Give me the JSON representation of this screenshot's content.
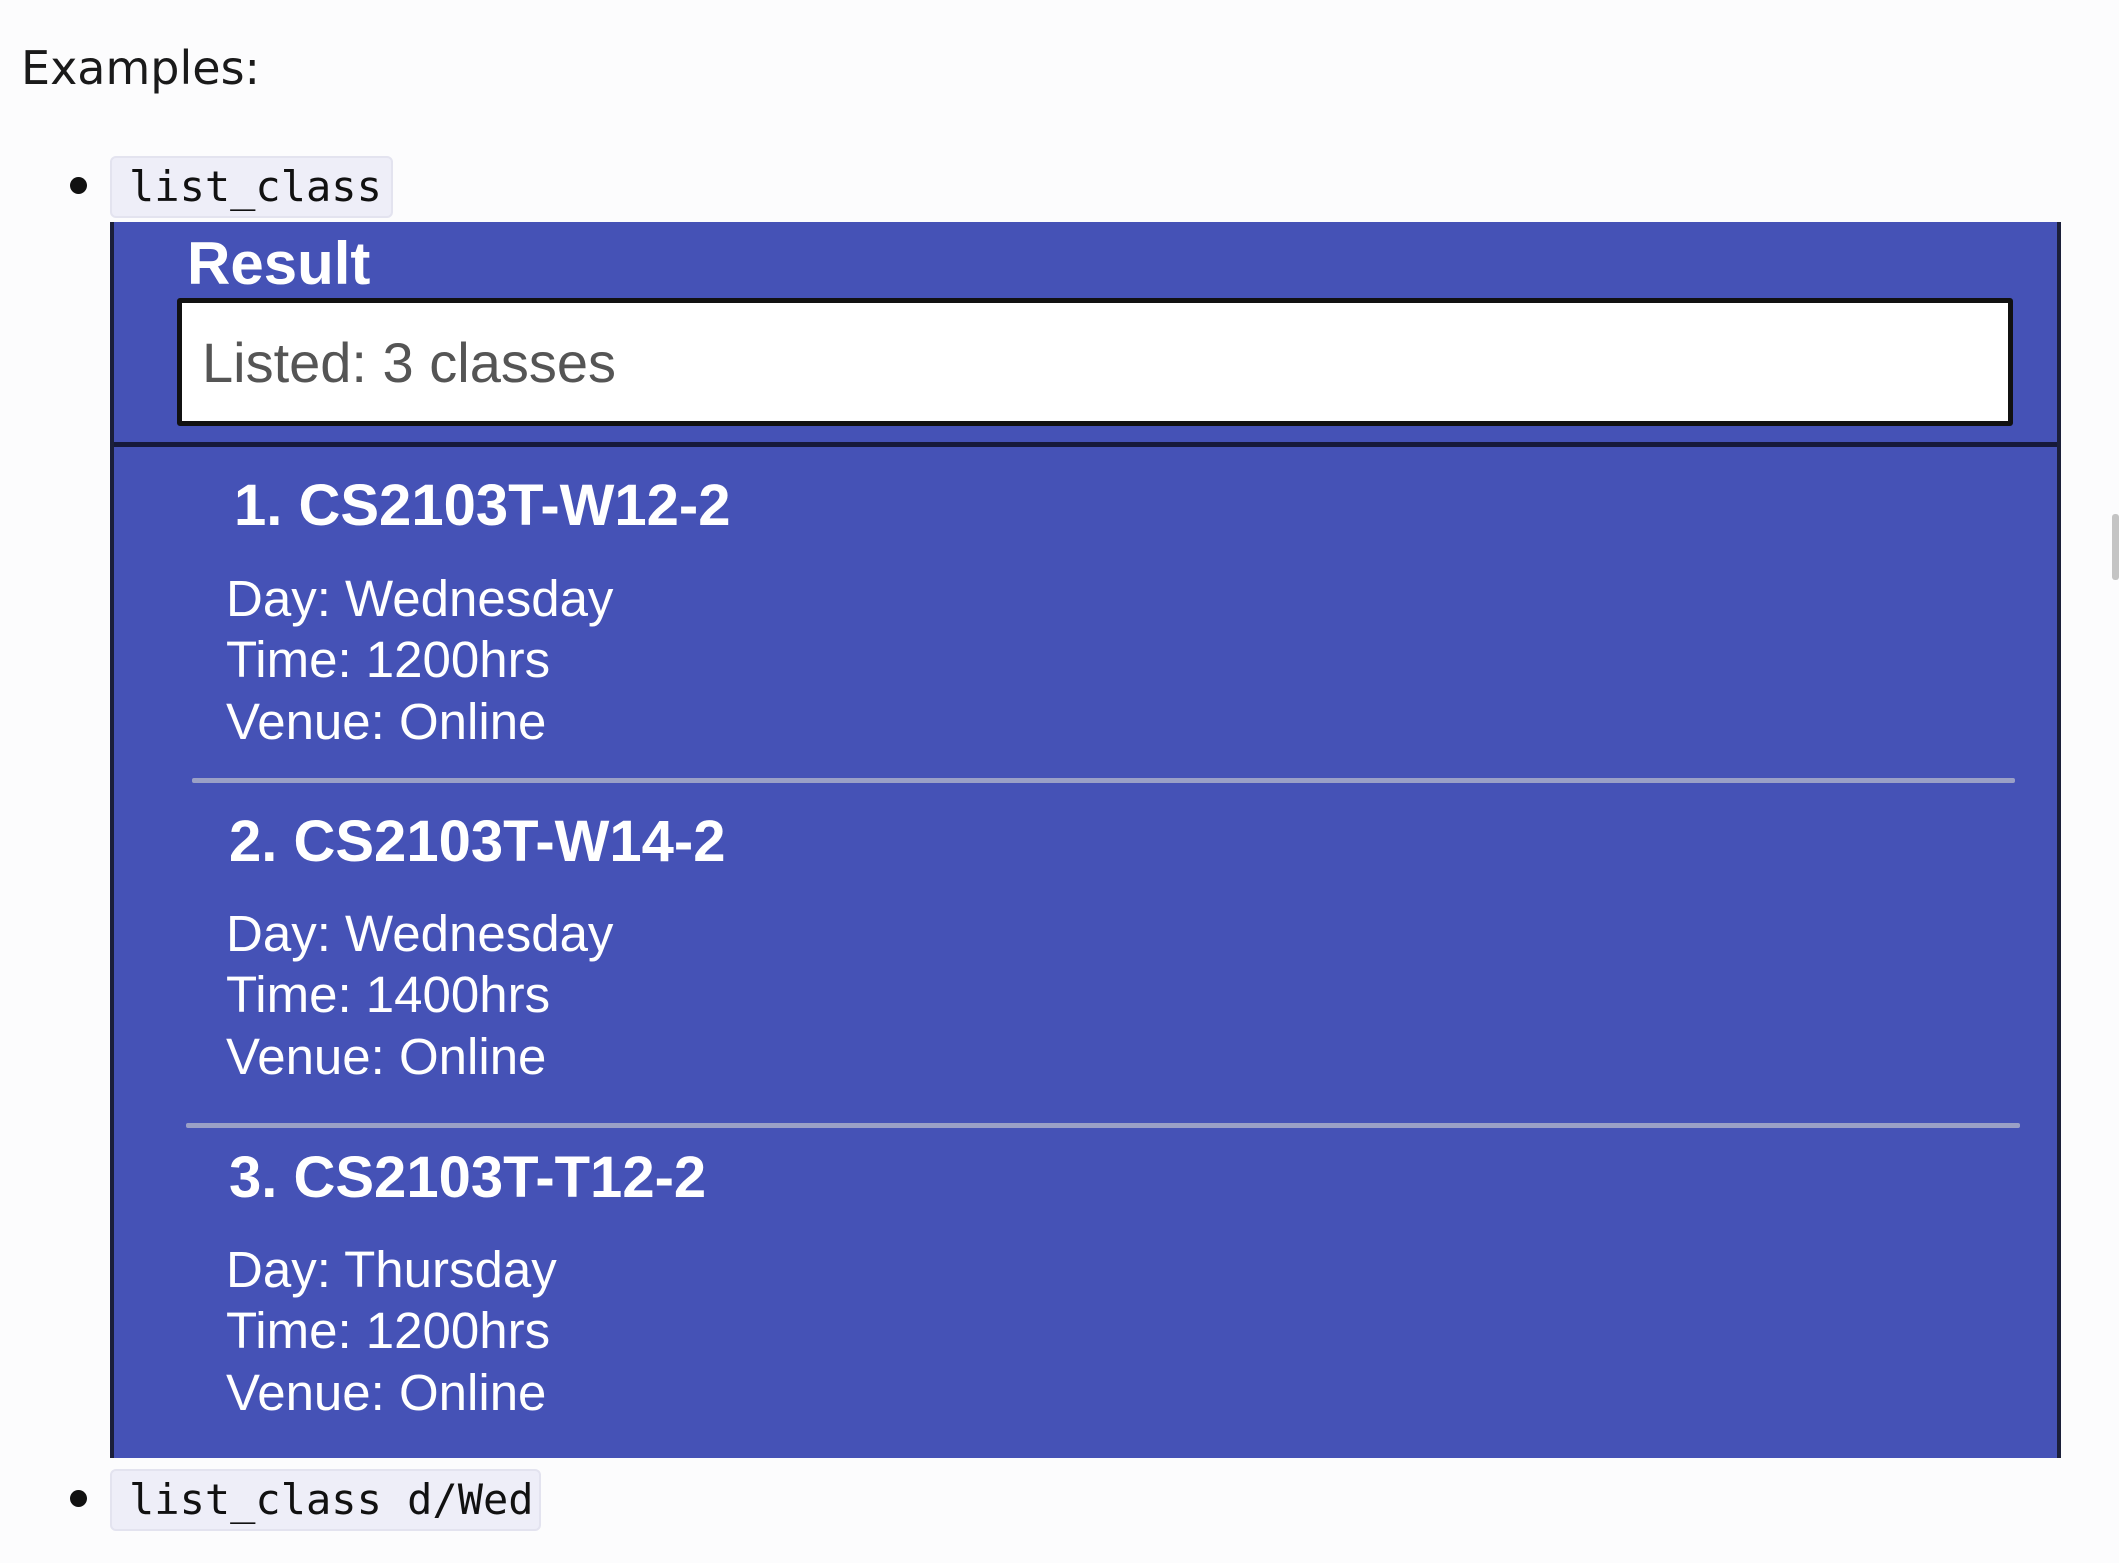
{
  "heading": "Examples:",
  "examples": [
    {
      "command": "list_class"
    },
    {
      "command": "list_class d/Wed"
    }
  ],
  "result": {
    "title": "Result",
    "message": "Listed: 3 classes"
  },
  "classes": [
    {
      "title": "1. CS2103T-W12-2",
      "day": "Day: Wednesday",
      "time": "Time: 1200hrs",
      "venue": "Venue: Online"
    },
    {
      "title": "2. CS2103T-W14-2",
      "day": "Day: Wednesday",
      "time": "Time: 1400hrs",
      "venue": "Venue: Online"
    },
    {
      "title": "3. CS2103T-T12-2",
      "day": "Day: Thursday",
      "time": "Time: 1200hrs",
      "venue": "Venue: Online"
    }
  ],
  "colors": {
    "panel": "#4552b6",
    "panel_border": "#1b1f3a",
    "code_background": "#eeeef8",
    "separator": "#9aa0c6"
  }
}
